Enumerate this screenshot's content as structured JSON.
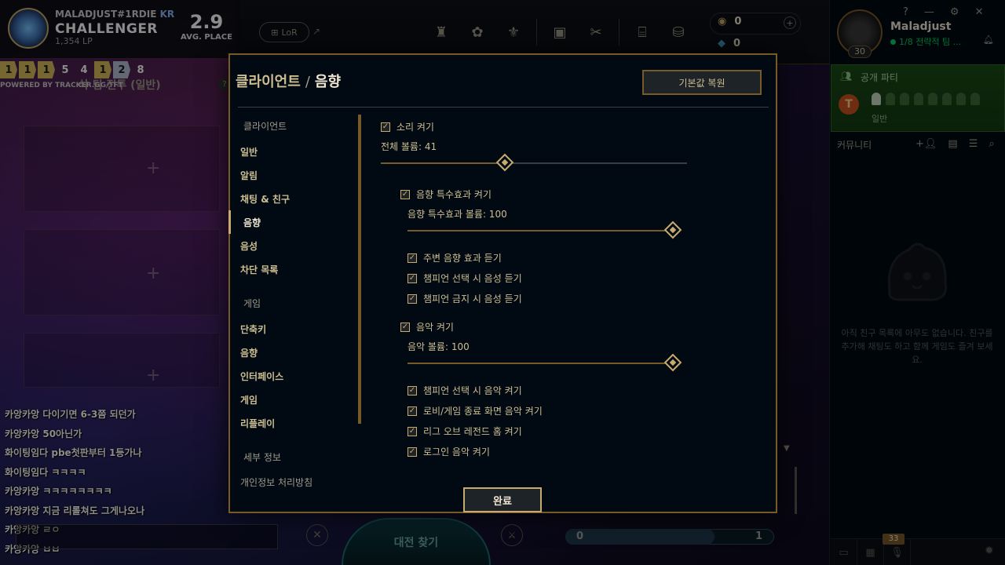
{
  "tracker": {
    "name": "MALADJUST#1RDIE",
    "region": "KR",
    "rank": "CHALLENGER",
    "lp": "1,354 LP",
    "avg_place": "2.9",
    "avg_label": "AVG. PLACE",
    "placements": [
      "1",
      "1",
      "1",
      "5",
      "4",
      "1",
      "2",
      "8"
    ],
    "powered_by": "POWERED BY TRACKER.GG/TFT"
  },
  "topbar": {
    "lor_label": "LoR",
    "rp": "0",
    "be": "0"
  },
  "lobby": {
    "title": "삭 팀 전투 (일반)"
  },
  "chat": {
    "lines": [
      "카앙카앙  다이기면 6-3쯤 되던가",
      "카앙카앙  50아닌가",
      "화이팅임다  pbe첫판부터 1등가나",
      "화이팅임다  ㅋㅋㅋㅋ",
      "카앙카앙  ㅋㅋㅋㅋㅋㅋㅋㅋ",
      "카앙카앙  지금 리롤쳐도 그게나오나",
      "카앙카앙  ㄹㅇ",
      "카앙카앙  ㅂㅂ"
    ]
  },
  "bottom": {
    "find_match": "대전 찾기",
    "count_left": "0",
    "count_right": "1"
  },
  "social": {
    "username": "Maladjust",
    "level": "30",
    "status": "1/8 전략적 팀 ...",
    "party_title": "공개 파티",
    "party_mode": "일반",
    "community": "커뮤니티",
    "empty_message": "아직 친구 목록에 아무도 없습니다. 친구를 추가해 채팅도 하고 함께 게임도 즐겨 보세요.",
    "notif_count": "33"
  },
  "modal": {
    "title_section": "클라이언트",
    "title_page": "음향",
    "restore_label": "기본값 복원",
    "done_label": "완료",
    "nav": {
      "client_header": "클라이언트",
      "client_items": [
        "일반",
        "알림",
        "채팅 & 친구",
        "음향",
        "음성",
        "차단 목록"
      ],
      "game_header": "게임",
      "game_items": [
        "단축키",
        "음향",
        "인터페이스",
        "게임",
        "리플레이"
      ],
      "info_header": "세부 정보",
      "info_items": [
        "개인정보 처리방침"
      ]
    },
    "sound": {
      "master_toggle": "소리 켜기",
      "master_volume_label": "전체 볼륨: 41",
      "master_volume": 41,
      "sfx_toggle": "음향 특수효과 켜기",
      "sfx_volume_label": "음향 특수효과 볼륨: 100",
      "sfx_volume": 100,
      "sfx_options": [
        "주변 음향 효과 듣기",
        "챔피언 선택 시 음성 듣기",
        "챔피언 금지 시 음성 듣기"
      ],
      "music_toggle": "음악 켜기",
      "music_volume_label": "음악 볼륨: 100",
      "music_volume": 100,
      "music_options": [
        "챔피언 선택 시 음악 켜기",
        "로비/게임 종료 화면 음악 켜기",
        "리그 오브 레전드 홈 켜기",
        "로그인 음악 켜기"
      ]
    }
  }
}
